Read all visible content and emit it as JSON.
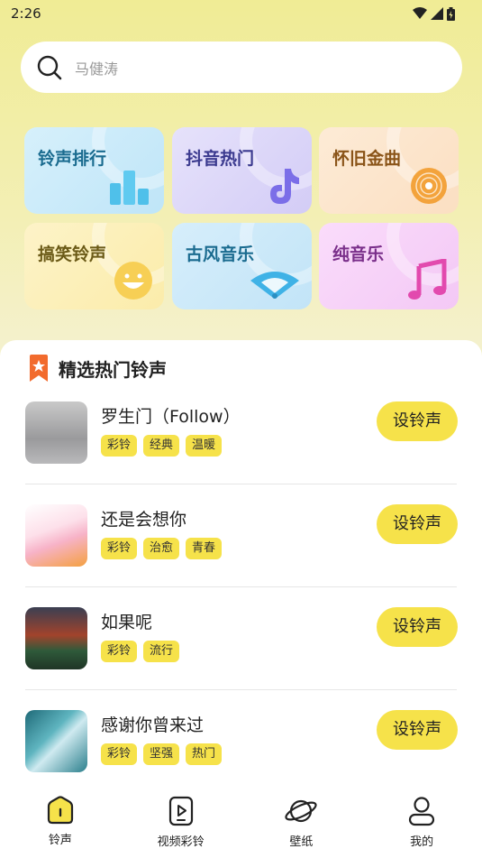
{
  "status_bar": {
    "time": "2:26"
  },
  "search": {
    "placeholder": "马健涛"
  },
  "categories": [
    {
      "label": "铃声排行",
      "icon": "bar-chart-icon"
    },
    {
      "label": "抖音热门",
      "icon": "tiktok-note-icon"
    },
    {
      "label": "怀旧金曲",
      "icon": "vinyl-disc-icon"
    },
    {
      "label": "搞笑铃声",
      "icon": "smiley-icon"
    },
    {
      "label": "古风音乐",
      "icon": "folding-fan-icon"
    },
    {
      "label": "纯音乐",
      "icon": "music-note-icon"
    }
  ],
  "section": {
    "title": "精选热门铃声"
  },
  "songs": [
    {
      "title": "罗生门（Follow）",
      "tags": [
        "彩铃",
        "经典",
        "温暖"
      ],
      "button": "设铃声"
    },
    {
      "title": "还是会想你",
      "tags": [
        "彩铃",
        "治愈",
        "青春"
      ],
      "button": "设铃声"
    },
    {
      "title": "如果呢",
      "tags": [
        "彩铃",
        "流行"
      ],
      "button": "设铃声"
    },
    {
      "title": "感谢你曾来过",
      "tags": [
        "彩铃",
        "坚强",
        "热门"
      ],
      "button": "设铃声"
    }
  ],
  "nav": [
    {
      "label": "铃声",
      "icon": "home-bell-icon"
    },
    {
      "label": "视频彩铃",
      "icon": "video-ringtone-icon"
    },
    {
      "label": "壁纸",
      "icon": "planet-icon"
    },
    {
      "label": "我的",
      "icon": "person-icon"
    }
  ],
  "colors": {
    "accent": "#f6e24a"
  }
}
